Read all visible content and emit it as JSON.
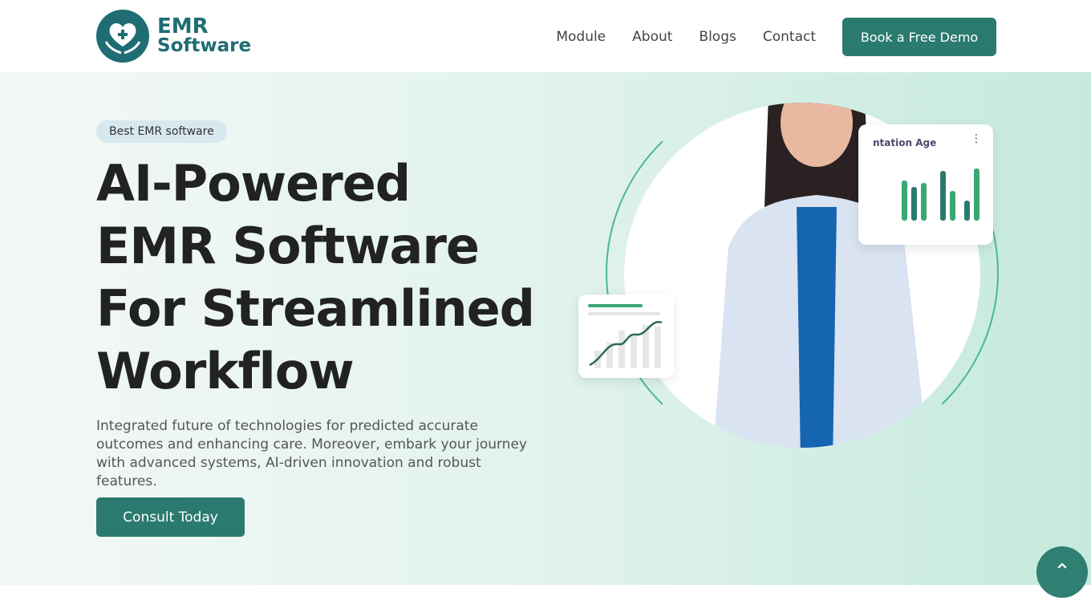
{
  "brand": {
    "line1": "EMR",
    "line2": "Software"
  },
  "nav": {
    "items": [
      "Module",
      "About",
      "Blogs",
      "Contact"
    ],
    "cta": "Book a Free Demo"
  },
  "hero": {
    "badge": "Best EMR software",
    "title": "AI-Powered EMR Software For Streamlined Workflow",
    "description": "Integrated future of technologies for predicted accurate outcomes and enhancing care. Moreover, embark your journey with advanced systems, AI-driven innovation and robust features.",
    "cta": "Consult Today",
    "card_title": "ntation Age"
  },
  "colors": {
    "accent": "#2b7a70",
    "brand": "#1f6d73",
    "chart_green": "#3aa872"
  },
  "icons": {
    "scroll_top": "chevron-up-icon",
    "card_menu": "more-vertical-icon"
  }
}
